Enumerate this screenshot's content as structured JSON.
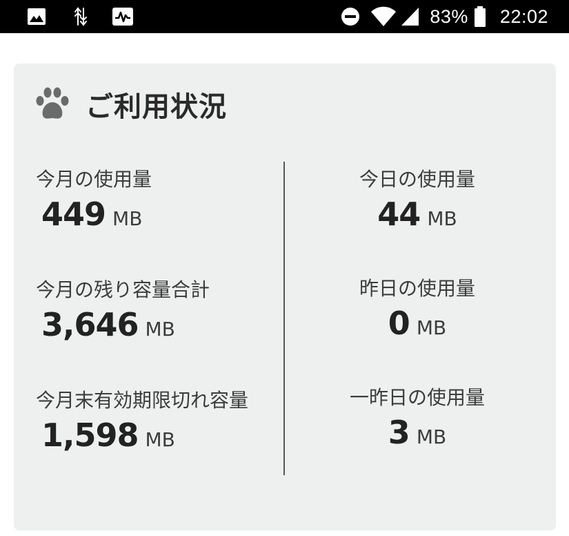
{
  "status_bar": {
    "battery_percent": "83%",
    "time": "22:02",
    "icons": [
      "image-icon",
      "data-transfer-icon",
      "activity-icon",
      "do-not-disturb-icon",
      "wifi-icon",
      "cellular-signal-icon",
      "battery-icon"
    ]
  },
  "card": {
    "title": "ご利用状況",
    "title_icon": "paw-icon",
    "left": [
      {
        "label": "今月の使用量",
        "value": "449",
        "unit": "MB"
      },
      {
        "label": "今月の残り容量合計",
        "value": "3,646",
        "unit": "MB"
      },
      {
        "label": "今月末有効期限切れ容量",
        "value": "1,598",
        "unit": "MB"
      }
    ],
    "right": [
      {
        "label": "今日の使用量",
        "value": "44",
        "unit": "MB"
      },
      {
        "label": "昨日の使用量",
        "value": "0",
        "unit": "MB"
      },
      {
        "label": "一昨日の使用量",
        "value": "3",
        "unit": "MB"
      }
    ]
  },
  "colors": {
    "status_bar_bg": "#000000",
    "card_bg": "#eef0f0",
    "text_primary": "#222222",
    "text_secondary": "#3c3c3c",
    "icon_gray": "#6b6b6b"
  }
}
